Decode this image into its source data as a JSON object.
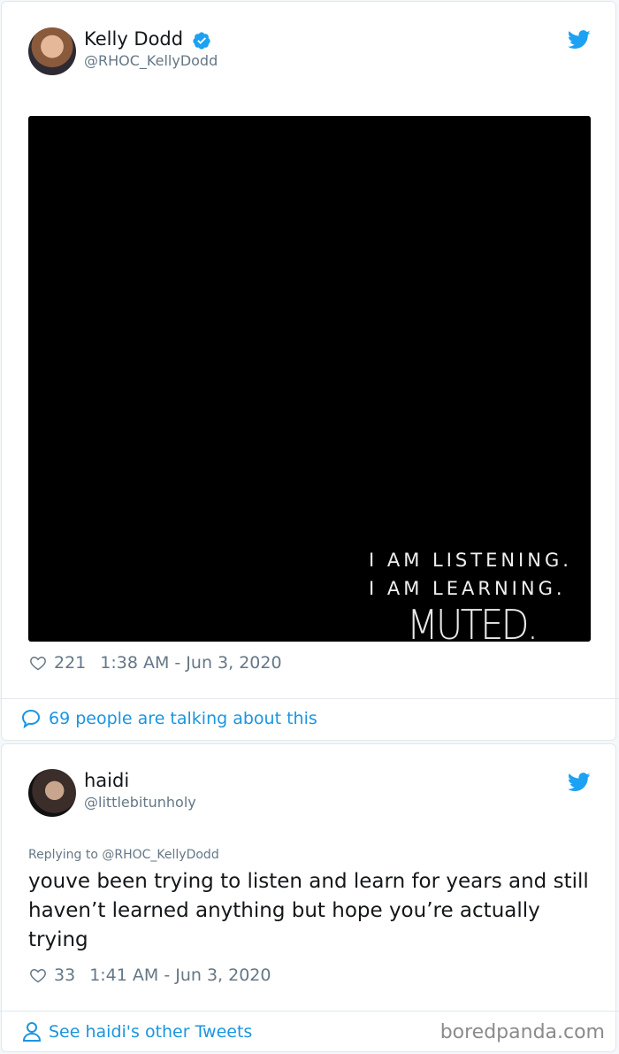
{
  "tweet1": {
    "author_name": "Kelly Dodd",
    "author_handle": "@RHOC_KellyDodd",
    "media": {
      "title": "MUTED.",
      "line1": "I AM LISTENING.",
      "line2": "I AM LEARNING."
    },
    "likes": "221",
    "timestamp": "1:38 AM - Jun 3, 2020",
    "talking": "69 people are talking about this"
  },
  "tweet2": {
    "author_name": "haidi",
    "author_handle": "@littlebitunholy",
    "replying_to": "Replying to @RHOC_KellyDodd",
    "text": "youve been trying to listen and learn for years and still haven’t learned anything but hope you’re actually trying",
    "likes": "33",
    "timestamp": "1:41 AM - Jun 3, 2020",
    "see_other": "See haidi's other Tweets"
  },
  "watermark": "boredpanda.com",
  "colors": {
    "twitter_blue": "#1da1f2",
    "link_blue": "#1b95e0",
    "meta_gray": "#657786"
  },
  "icons": [
    "verified-badge-icon",
    "twitter-bird-icon",
    "heart-icon",
    "speech-bubble-icon",
    "person-icon"
  ]
}
